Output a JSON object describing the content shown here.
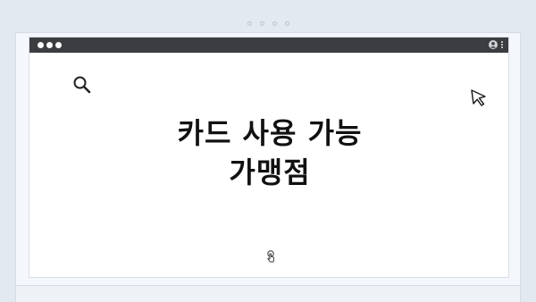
{
  "pager": {
    "count": 4
  },
  "window": {
    "titlebar": {
      "buttons": [
        "dot",
        "dot",
        "dot"
      ],
      "right_icons": [
        "user-icon",
        "kebab-menu-icon"
      ]
    },
    "icons": [
      "search-icon",
      "cursor-icon",
      "touch-icon"
    ],
    "headline": {
      "line1": "카드 사용 가능",
      "line2": "가맹점"
    }
  },
  "colors": {
    "background": "#e3e9f1",
    "titlebar": "#3b3d40",
    "text": "#111111"
  }
}
